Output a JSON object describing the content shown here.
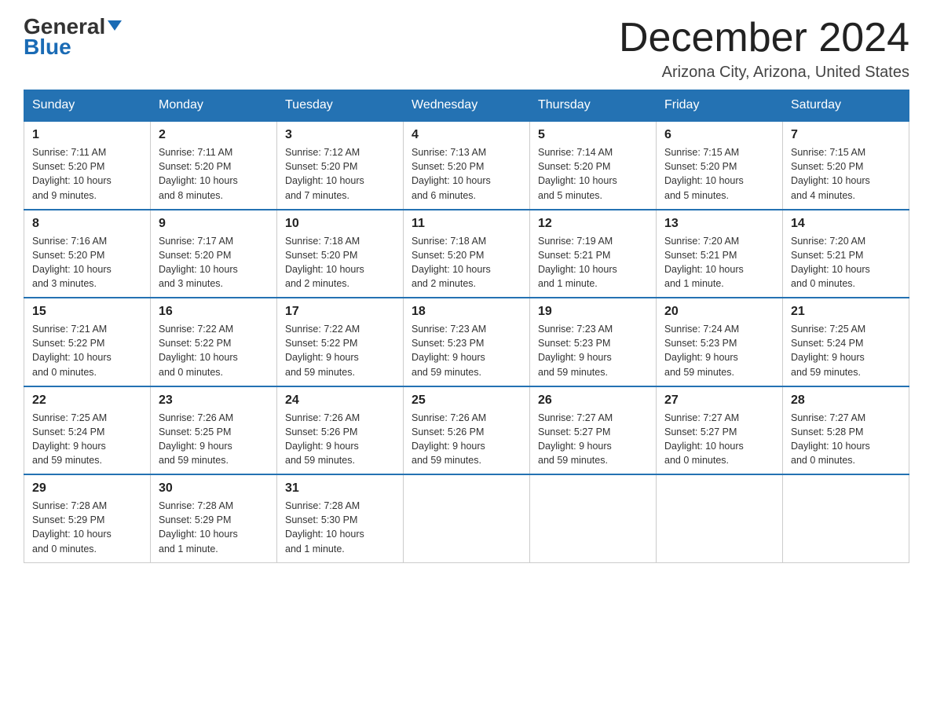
{
  "logo": {
    "general": "General",
    "blue": "Blue"
  },
  "header": {
    "month": "December 2024",
    "location": "Arizona City, Arizona, United States"
  },
  "days_of_week": [
    "Sunday",
    "Monday",
    "Tuesday",
    "Wednesday",
    "Thursday",
    "Friday",
    "Saturday"
  ],
  "weeks": [
    [
      {
        "day": "1",
        "sunrise": "7:11 AM",
        "sunset": "5:20 PM",
        "daylight": "10 hours and 9 minutes."
      },
      {
        "day": "2",
        "sunrise": "7:11 AM",
        "sunset": "5:20 PM",
        "daylight": "10 hours and 8 minutes."
      },
      {
        "day": "3",
        "sunrise": "7:12 AM",
        "sunset": "5:20 PM",
        "daylight": "10 hours and 7 minutes."
      },
      {
        "day": "4",
        "sunrise": "7:13 AM",
        "sunset": "5:20 PM",
        "daylight": "10 hours and 6 minutes."
      },
      {
        "day": "5",
        "sunrise": "7:14 AM",
        "sunset": "5:20 PM",
        "daylight": "10 hours and 5 minutes."
      },
      {
        "day": "6",
        "sunrise": "7:15 AM",
        "sunset": "5:20 PM",
        "daylight": "10 hours and 5 minutes."
      },
      {
        "day": "7",
        "sunrise": "7:15 AM",
        "sunset": "5:20 PM",
        "daylight": "10 hours and 4 minutes."
      }
    ],
    [
      {
        "day": "8",
        "sunrise": "7:16 AM",
        "sunset": "5:20 PM",
        "daylight": "10 hours and 3 minutes."
      },
      {
        "day": "9",
        "sunrise": "7:17 AM",
        "sunset": "5:20 PM",
        "daylight": "10 hours and 3 minutes."
      },
      {
        "day": "10",
        "sunrise": "7:18 AM",
        "sunset": "5:20 PM",
        "daylight": "10 hours and 2 minutes."
      },
      {
        "day": "11",
        "sunrise": "7:18 AM",
        "sunset": "5:20 PM",
        "daylight": "10 hours and 2 minutes."
      },
      {
        "day": "12",
        "sunrise": "7:19 AM",
        "sunset": "5:21 PM",
        "daylight": "10 hours and 1 minute."
      },
      {
        "day": "13",
        "sunrise": "7:20 AM",
        "sunset": "5:21 PM",
        "daylight": "10 hours and 1 minute."
      },
      {
        "day": "14",
        "sunrise": "7:20 AM",
        "sunset": "5:21 PM",
        "daylight": "10 hours and 0 minutes."
      }
    ],
    [
      {
        "day": "15",
        "sunrise": "7:21 AM",
        "sunset": "5:22 PM",
        "daylight": "10 hours and 0 minutes."
      },
      {
        "day": "16",
        "sunrise": "7:22 AM",
        "sunset": "5:22 PM",
        "daylight": "10 hours and 0 minutes."
      },
      {
        "day": "17",
        "sunrise": "7:22 AM",
        "sunset": "5:22 PM",
        "daylight": "9 hours and 59 minutes."
      },
      {
        "day": "18",
        "sunrise": "7:23 AM",
        "sunset": "5:23 PM",
        "daylight": "9 hours and 59 minutes."
      },
      {
        "day": "19",
        "sunrise": "7:23 AM",
        "sunset": "5:23 PM",
        "daylight": "9 hours and 59 minutes."
      },
      {
        "day": "20",
        "sunrise": "7:24 AM",
        "sunset": "5:23 PM",
        "daylight": "9 hours and 59 minutes."
      },
      {
        "day": "21",
        "sunrise": "7:25 AM",
        "sunset": "5:24 PM",
        "daylight": "9 hours and 59 minutes."
      }
    ],
    [
      {
        "day": "22",
        "sunrise": "7:25 AM",
        "sunset": "5:24 PM",
        "daylight": "9 hours and 59 minutes."
      },
      {
        "day": "23",
        "sunrise": "7:26 AM",
        "sunset": "5:25 PM",
        "daylight": "9 hours and 59 minutes."
      },
      {
        "day": "24",
        "sunrise": "7:26 AM",
        "sunset": "5:26 PM",
        "daylight": "9 hours and 59 minutes."
      },
      {
        "day": "25",
        "sunrise": "7:26 AM",
        "sunset": "5:26 PM",
        "daylight": "9 hours and 59 minutes."
      },
      {
        "day": "26",
        "sunrise": "7:27 AM",
        "sunset": "5:27 PM",
        "daylight": "9 hours and 59 minutes."
      },
      {
        "day": "27",
        "sunrise": "7:27 AM",
        "sunset": "5:27 PM",
        "daylight": "10 hours and 0 minutes."
      },
      {
        "day": "28",
        "sunrise": "7:27 AM",
        "sunset": "5:28 PM",
        "daylight": "10 hours and 0 minutes."
      }
    ],
    [
      {
        "day": "29",
        "sunrise": "7:28 AM",
        "sunset": "5:29 PM",
        "daylight": "10 hours and 0 minutes."
      },
      {
        "day": "30",
        "sunrise": "7:28 AM",
        "sunset": "5:29 PM",
        "daylight": "10 hours and 1 minute."
      },
      {
        "day": "31",
        "sunrise": "7:28 AM",
        "sunset": "5:30 PM",
        "daylight": "10 hours and 1 minute."
      },
      null,
      null,
      null,
      null
    ]
  ],
  "labels": {
    "sunrise": "Sunrise:",
    "sunset": "Sunset:",
    "daylight": "Daylight:"
  }
}
